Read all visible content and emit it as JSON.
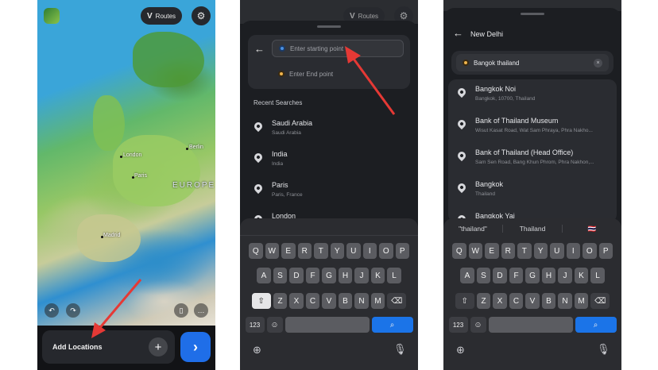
{
  "phone1": {
    "routes_label": "Routes",
    "map_labels": {
      "london": "London",
      "paris": "Paris",
      "berlin": "Berlin",
      "madrid": "Madrid",
      "europe": "EUROPE"
    },
    "add_locations_label": "Add Locations",
    "plus_glyph": "+",
    "go_glyph": "›",
    "settings_glyph": "⚙"
  },
  "phone2": {
    "routes_label": "Routes",
    "start_placeholder": "Enter starting point",
    "end_placeholder": "Enter End point",
    "recent_label": "Recent Searches",
    "recent": [
      {
        "title": "Saudi Arabia",
        "sub": "Saudi Arabia"
      },
      {
        "title": "India",
        "sub": "India"
      },
      {
        "title": "Paris",
        "sub": "Paris, France"
      },
      {
        "title": "London",
        "sub": ""
      }
    ]
  },
  "phone3": {
    "header_title": "New Delhi",
    "search_value": "Bangok thailand",
    "results": [
      {
        "title": "Bangkok Noi",
        "sub": "Bangkok, 10700, Thailand"
      },
      {
        "title": "Bank of Thailand Museum",
        "sub": "Wisut Kasat Road, Wat Sam Phraya, Phra Nakho..."
      },
      {
        "title": "Bank of Thailand (Head Office)",
        "sub": "Sam Sen Road, Bang Khun Phrom, Phra Nakhon,..."
      },
      {
        "title": "Bangkok",
        "sub": "Thailand"
      },
      {
        "title": "Bangkok Yai",
        "sub": ""
      }
    ],
    "suggestions": [
      "\"thailand\"",
      "Thailand",
      "🇹🇭"
    ]
  },
  "keyboard": {
    "row1": [
      "Q",
      "W",
      "E",
      "R",
      "T",
      "Y",
      "U",
      "I",
      "O",
      "P"
    ],
    "row2": [
      "A",
      "S",
      "D",
      "F",
      "G",
      "H",
      "J",
      "K",
      "L"
    ],
    "row3": [
      "Z",
      "X",
      "C",
      "V",
      "B",
      "N",
      "M"
    ],
    "shift": "⇧",
    "backspace": "⌫",
    "numbers": "123",
    "emoji": "☺",
    "search": "⌕",
    "globe": "⊕",
    "mic": "🎙"
  },
  "colors": {
    "accent_blue": "#1f6ee8",
    "arrow_red": "#e53935",
    "sheet_bg": "#1c1e22"
  }
}
